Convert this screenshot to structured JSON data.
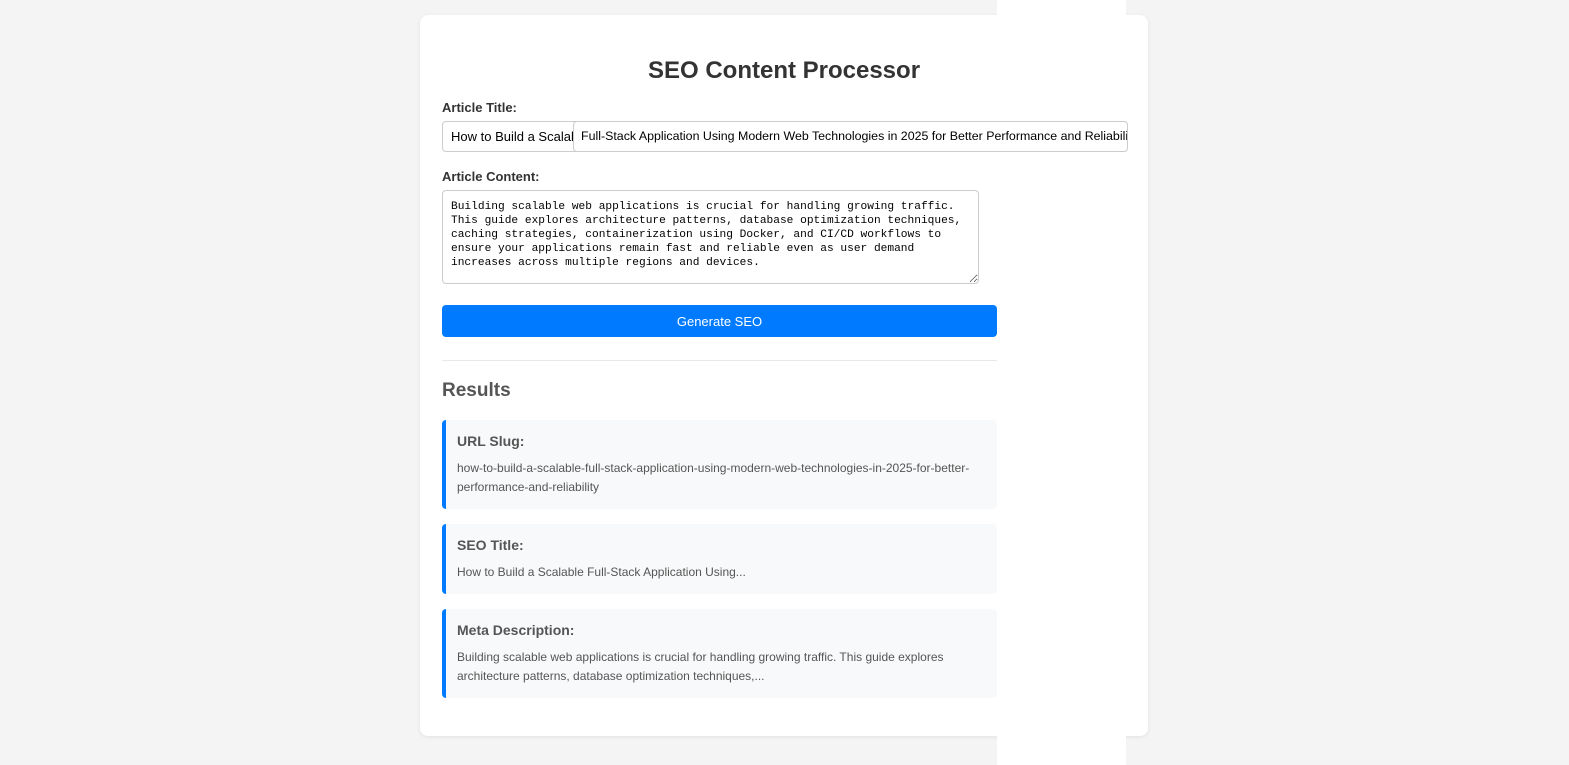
{
  "header": {
    "title": "SEO Content Processor"
  },
  "form": {
    "title_label": "Article Title:",
    "title_value_visible": "How to Build a Scalable",
    "title_value_overlay": "Full-Stack Application Using Modern Web Technologies in 2025 for Better Performance and Reliability",
    "content_label": "Article Content:",
    "content_value": "Building scalable web applications is crucial for handling growing traffic.\nThis guide explores architecture patterns, database optimization techniques,\ncaching strategies, containerization using Docker, and CI/CD workflows to\nensure your applications remain fast and reliable even as user demand\nincreases across multiple regions and devices.",
    "generate_label": "Generate SEO"
  },
  "results": {
    "heading": "Results",
    "items": [
      {
        "label": "URL Slug:",
        "value": "how-to-build-a-scalable-full-stack-application-using-modern-web-technologies-in-2025-for-better-performance-and-reliability"
      },
      {
        "label": "SEO Title:",
        "value": "How to Build a Scalable Full-Stack Application Using..."
      },
      {
        "label": "Meta Description:",
        "value": "Building scalable web applications is crucial for handling growing traffic. This guide explores architecture patterns, database optimization techniques,..."
      }
    ]
  },
  "colors": {
    "accent": "#007bff",
    "background": "#f4f4f4",
    "card": "#ffffff",
    "result_bg": "#f8f9fa"
  }
}
